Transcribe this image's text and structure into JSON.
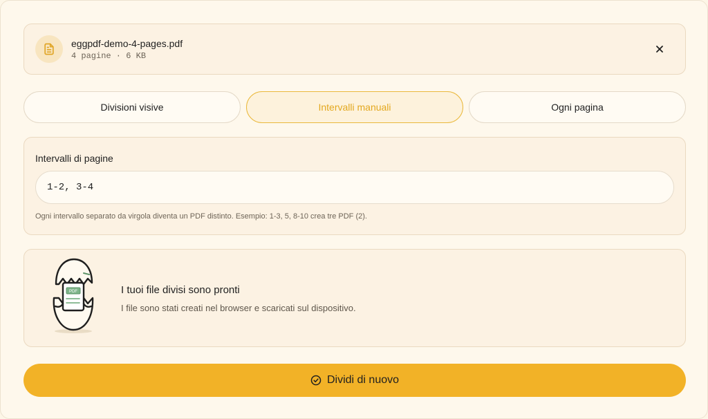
{
  "file": {
    "name": "eggpdf-demo-4-pages.pdf",
    "meta": "4 pagine · 6 KB",
    "icon": "document-icon",
    "close_icon": "close-icon"
  },
  "tabs": [
    {
      "label": "Divisioni visive",
      "active": false
    },
    {
      "label": "Intervalli manuali",
      "active": true
    },
    {
      "label": "Ogni pagina",
      "active": false
    }
  ],
  "ranges": {
    "label": "Intervalli di pagine",
    "value": "1-2, 3-4",
    "hint": "Ogni intervallo separato da virgola diventa un PDF distinto. Esempio: 1-3, 5, 8-10 crea tre PDF (2)."
  },
  "result": {
    "title": "I tuoi file divisi sono pronti",
    "description": "I file sono stati creati nel browser e scaricati sul dispositivo.",
    "illustration_label": "PDF"
  },
  "action": {
    "label": "Dividi di nuovo",
    "icon": "check-circle-icon"
  },
  "colors": {
    "accent": "#f2b227",
    "accent_text": "#e3a81f",
    "background": "#fef8ec"
  }
}
